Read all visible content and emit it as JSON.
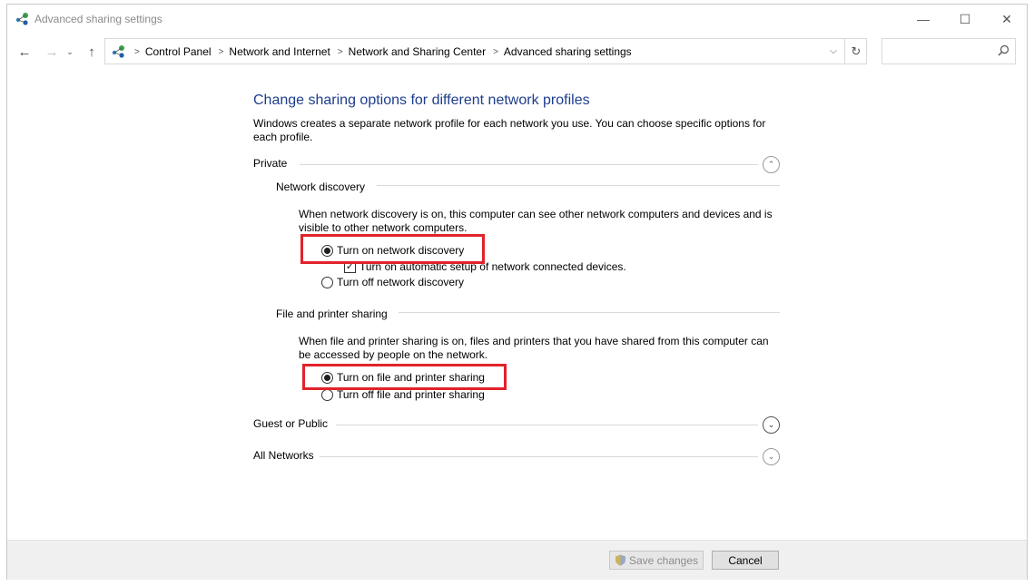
{
  "window": {
    "title": "Advanced sharing settings",
    "controls": {
      "minimize": "—",
      "maximize": "☐",
      "close": "✕"
    }
  },
  "nav": {
    "back": "←",
    "forward": "→",
    "recent": "⌄",
    "up": "↑"
  },
  "breadcrumb": [
    "Control Panel",
    "Network and Internet",
    "Network and Sharing Center",
    "Advanced sharing settings"
  ],
  "search": {
    "placeholder": ""
  },
  "main": {
    "heading": "Change sharing options for different network profiles",
    "description": "Windows creates a separate network profile for each network you use. You can choose specific options for each profile.",
    "profiles": {
      "private": {
        "label": "Private",
        "expanded": true,
        "network_discovery": {
          "title": "Network discovery",
          "description": "When network discovery is on, this computer can see other network computers and devices and is visible to other network computers.",
          "option_on": "Turn on network discovery",
          "auto_setup": "Turn on automatic setup of network connected devices.",
          "option_off": "Turn off network discovery",
          "selected": "on",
          "auto_setup_checked": true
        },
        "file_printer_sharing": {
          "title": "File and printer sharing",
          "description": "When file and printer sharing is on, files and printers that you have shared from this computer can be accessed by people on the network.",
          "option_on": "Turn on file and printer sharing",
          "option_off": "Turn off file and printer sharing",
          "selected": "on"
        }
      },
      "guest_public": {
        "label": "Guest or Public",
        "expanded": false
      },
      "all_networks": {
        "label": "All Networks",
        "expanded": false
      }
    }
  },
  "footer": {
    "save_label": "Save changes",
    "cancel_label": "Cancel"
  },
  "colors": {
    "heading": "#1e3e8c",
    "highlight": "#e2222a",
    "footer_bg": "#f0f0f0"
  },
  "icons": {
    "app": "network-sharing-icon",
    "search": "search-icon",
    "refresh": "refresh-icon",
    "shield": "uac-shield-icon",
    "chevron_up": "chevron-up-icon",
    "chevron_down": "chevron-down-icon"
  }
}
